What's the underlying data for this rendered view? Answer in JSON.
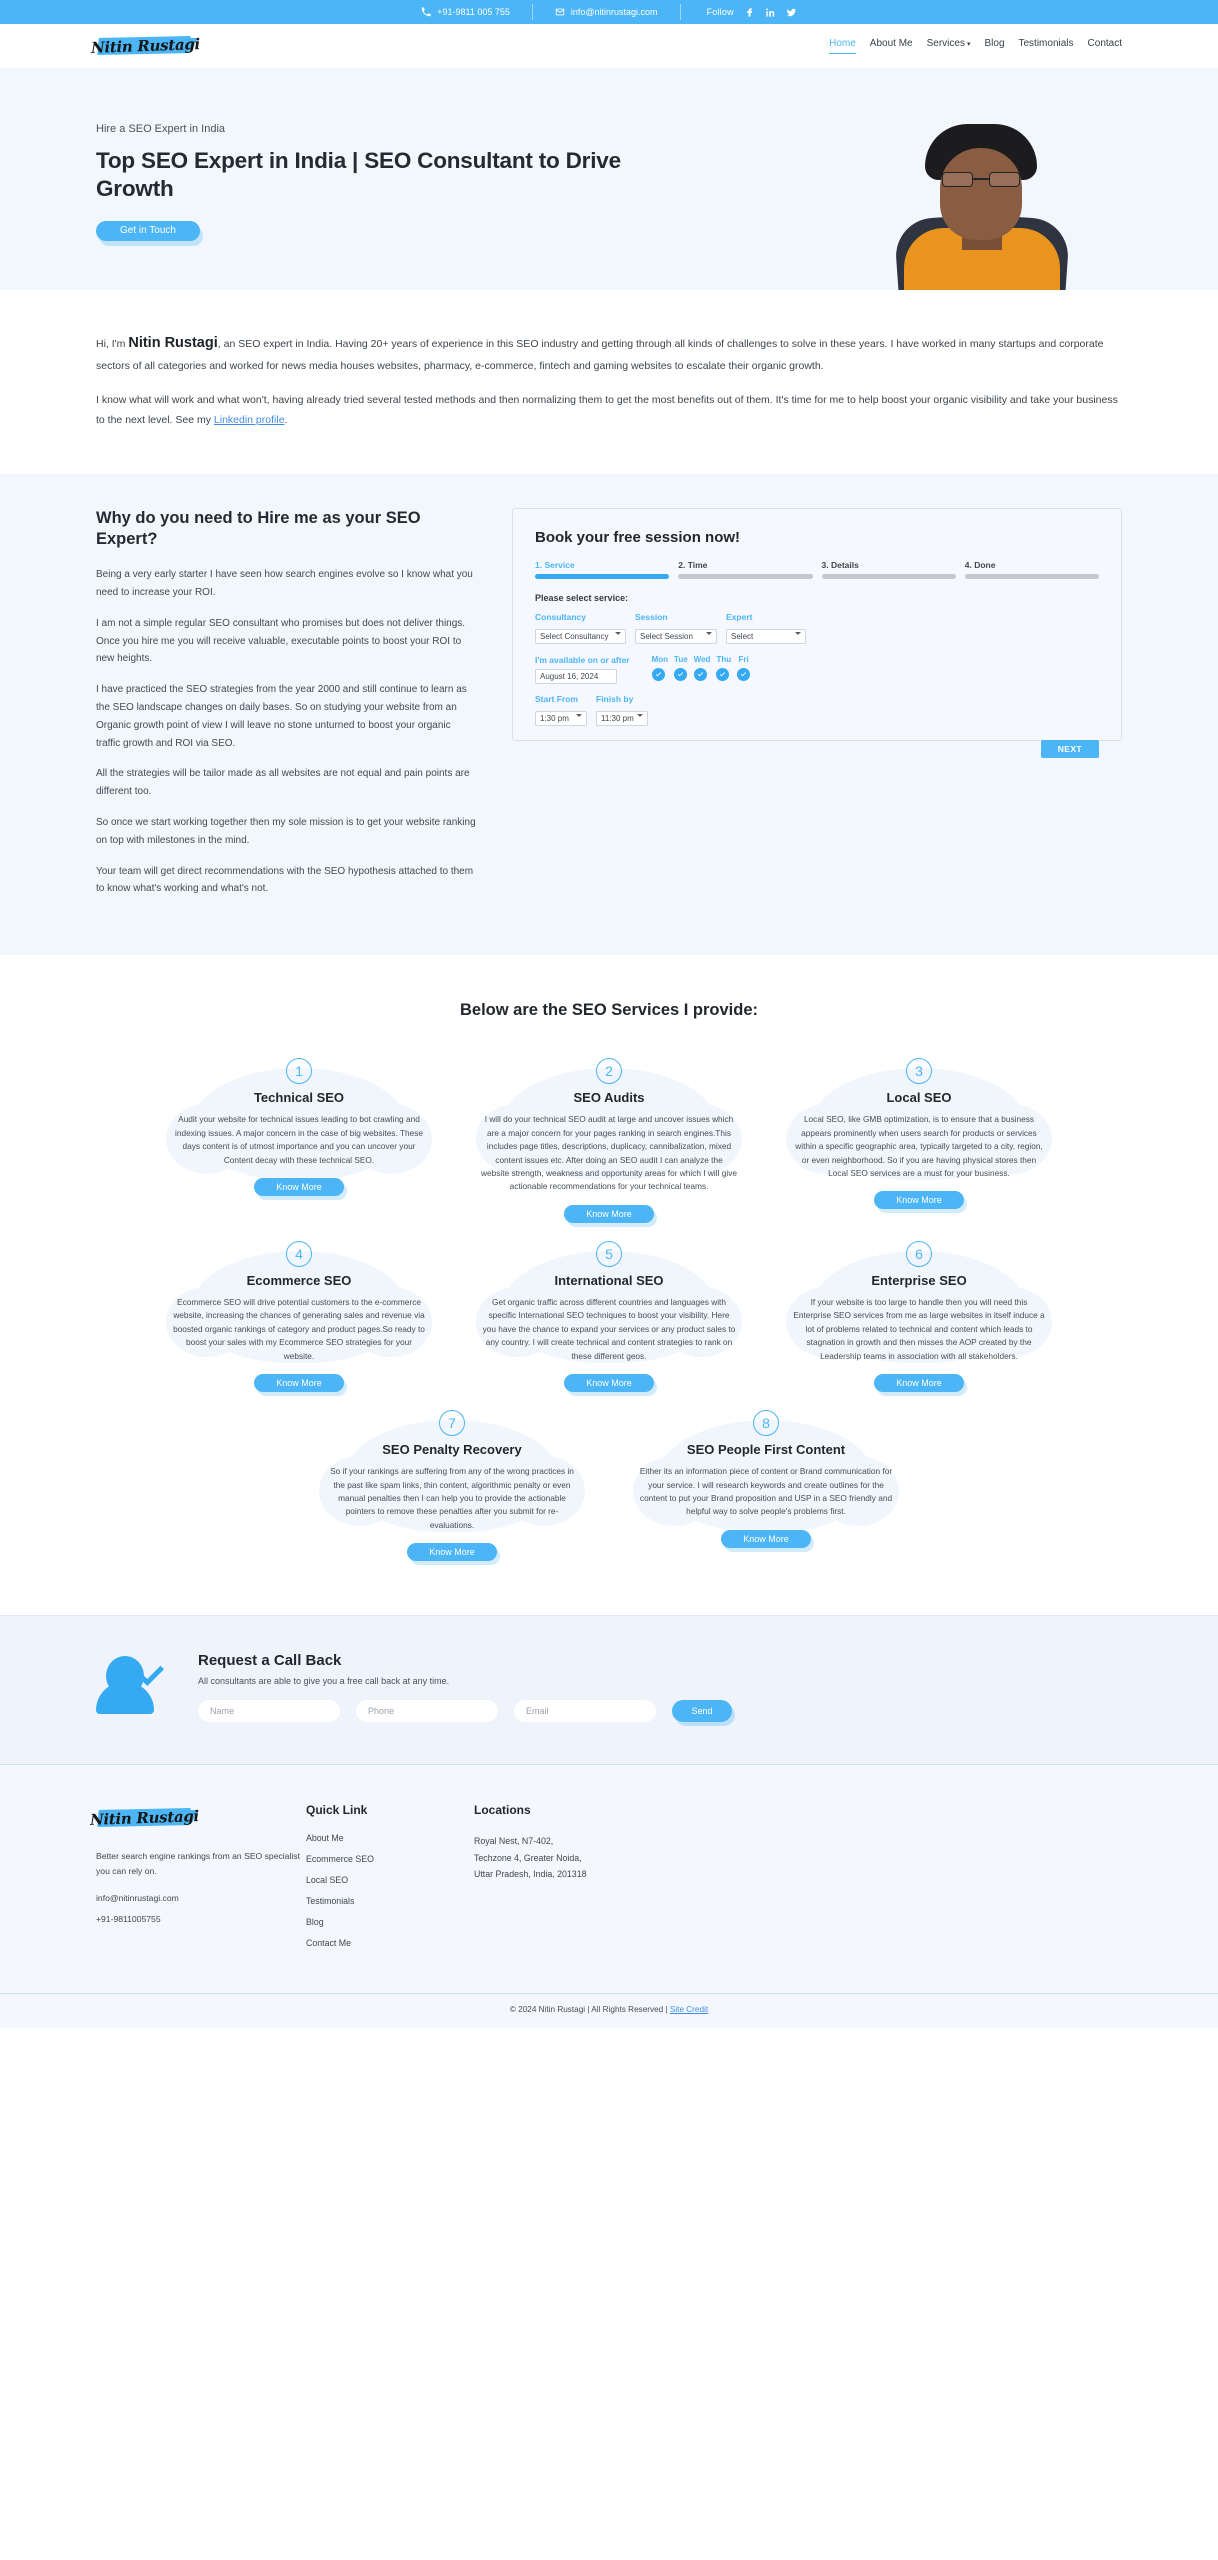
{
  "topbar": {
    "phone": "+91-9811 005 755",
    "email": "info@nitinrustagi.com",
    "follow_label": "Follow",
    "socials": [
      "facebook-icon",
      "linkedin-icon",
      "twitter-icon"
    ]
  },
  "nav": {
    "logo_text": "Nitin Rustagi",
    "items": [
      {
        "label": "Home",
        "active": true
      },
      {
        "label": "About Me",
        "active": false
      },
      {
        "label": "Services",
        "active": false,
        "caret": "▾"
      },
      {
        "label": "Blog",
        "active": false
      },
      {
        "label": "Testimonials",
        "active": false
      },
      {
        "label": "Contact",
        "active": false
      }
    ]
  },
  "hero": {
    "kicker": "Hire a SEO Expert in India",
    "title": "Top SEO Expert in India | SEO Consultant to Drive Growth",
    "cta": "Get in Touch"
  },
  "intro": {
    "greeting": "Hi, I'm ",
    "name": "Nitin Rustagi",
    "p1_rest": ", an SEO expert in India. Having 20+ years of experience in this SEO industry and getting through all kinds of challenges to solve in these years. I have worked in many startups and corporate sectors of all categories and worked for news media houses websites, pharmacy, e-commerce, fintech and gaming websites to escalate their organic growth.",
    "p2_before": "I know what will work and what won't, having already tried several tested methods and then normalizing them to get the most benefits out of them. It's time for me to help boost your organic visibility and take your business to the next level. See my ",
    "p2_link": "Linkedin profile",
    "p2_after": "."
  },
  "why": {
    "title": "Why do you need to Hire me as your SEO Expert?",
    "paragraphs": [
      "Being a very early starter I have seen how search engines evolve so I know what you need to increase your ROI.",
      "I am not a simple regular SEO consultant who promises but does not deliver things. Once you hire me you will receive valuable, executable points to boost your ROI to new heights.",
      "I have practiced the SEO strategies from the year 2000 and still continue to learn as the SEO landscape changes on daily bases. So on studying your website from an Organic growth point of view I will leave no stone unturned to boost your organic traffic growth and ROI via SEO.",
      "All the strategies will be tailor made as all websites are not equal and pain points are different too.",
      "So once we start working together then my sole mission is to get your website ranking on top with milestones in the mind.",
      "Your team will get direct recommendations with the SEO hypothesis attached to them to know what's working and what's not."
    ]
  },
  "booking": {
    "title": "Book your free session now!",
    "steps": [
      {
        "label": "1. Service",
        "active": true
      },
      {
        "label": "2. Time",
        "active": false
      },
      {
        "label": "3. Details",
        "active": false
      },
      {
        "label": "4. Done",
        "active": false
      }
    ],
    "prompt": "Please select service:",
    "consultancy_label": "Consultancy",
    "consultancy_value": "Select Consultancy",
    "session_label": "Session",
    "session_value": "Select Session",
    "expert_label": "Expert",
    "expert_value": "Select",
    "available_label": "I'm available on or after",
    "date_value": "August 16, 2024",
    "days": [
      "Mon",
      "Tue",
      "Wed",
      "Thu",
      "Fri"
    ],
    "start_label": "Start From",
    "start_value": "1:30 pm",
    "finish_label": "Finish by",
    "finish_value": "11:30 pm",
    "next_label": "NEXT"
  },
  "services": {
    "heading": "Below are the SEO Services I provide:",
    "know_more": "Know More",
    "items": [
      {
        "num": "1",
        "title": "Technical SEO",
        "desc": "Audit your website for technical issues leading to bot crawling and indexing issues. A major concern in the case of big websites. These days content is of utmost importance and you can uncover your Content decay with these technical SEO."
      },
      {
        "num": "2",
        "title": "SEO Audits",
        "desc": "I will do your technical SEO audit at large and uncover issues which are a major concern for your pages ranking in search engines.This includes page titles, descriptions, duplicacy, cannibalization, mixed content issues etc. After doing an SEO audit I can analyze the website strength, weakness and opportunity areas for which I will give actionable recommendations for your technical teams."
      },
      {
        "num": "3",
        "title": "Local SEO",
        "desc": "Local SEO, like GMB optimization, is to ensure that a business appears prominently when users search for products or services within a specific geographic area, typically targeted to a city, region, or even neighborhood. So if you are having physical stores then Local SEO services are a must for your business."
      },
      {
        "num": "4",
        "title": "Ecommerce SEO",
        "desc": "Ecommerce SEO will drive potential customers to the e-commerce website, increasing the chances of generating sales and revenue via boosted organic rankings of category and product pages.So ready to boost your sales with my Ecommerce SEO strategies for your website."
      },
      {
        "num": "5",
        "title": "International SEO",
        "desc": "Get organic traffic across different countries and languages with specific International SEO techniques to boost your visibility. Here you have the chance to expand your services or any product sales to any country. I will create technical and content strategies to rank on these different geos."
      },
      {
        "num": "6",
        "title": "Enterprise SEO",
        "desc": "If your website is too large to handle then you will need this Enterprise SEO services from me as large websites in itself induce a lot of problems related to technical and content which leads to stagnation in growth and then misses the AOP created by the Leadership teams in association with all stakeholders."
      },
      {
        "num": "7",
        "title": "SEO Penalty Recovery",
        "desc": "So if your rankings are suffering from any of the wrong practices in the past like spam links, thin content, algorithmic penalty or even manual penalties then I can help you to provide the actionable pointers to remove these penalties after you submit for re-evaluations."
      },
      {
        "num": "8",
        "title": "SEO People First Content",
        "desc": "Either its an information piece of content or Brand communication for your service. I will research keywords and create outlines for the content to put your Brand proposition and USP in a SEO friendly and helpful way to solve people's problems first."
      }
    ]
  },
  "callback": {
    "title": "Request a Call Back",
    "subtitle": "All consultants are able to give you a free call back at any time.",
    "name_placeholder": "Name",
    "phone_placeholder": "Phone",
    "email_placeholder": "Email",
    "send_label": "Send"
  },
  "footer": {
    "logo_text": "Nitin Rustagi",
    "tagline": "Better search engine rankings from an SEO specialist you can rely on.",
    "email": "info@nitinrustagi.com",
    "phone": "+91-9811005755",
    "quick_link_head": "Quick Link",
    "quick_links": [
      "About Me",
      "Ecommerce SEO",
      "Local SEO",
      "Testimonials",
      "Blog",
      "Contact Me"
    ],
    "locations_head": "Locations",
    "address_line1": "Royal Nest, N7-402,",
    "address_line2": "Techzone 4, Greater Noida,",
    "address_line3": "Uttar Pradesh, India, 201318",
    "copyright": "© 2024 Nitin Rustagi | All Rights Reserved | ",
    "site_credit": "Site Credit"
  },
  "colors": {
    "accent": "#4cb5f5",
    "accent_dark": "#35aaf2",
    "hero_bg": "#f2f6fd",
    "text": "#2b3138"
  }
}
